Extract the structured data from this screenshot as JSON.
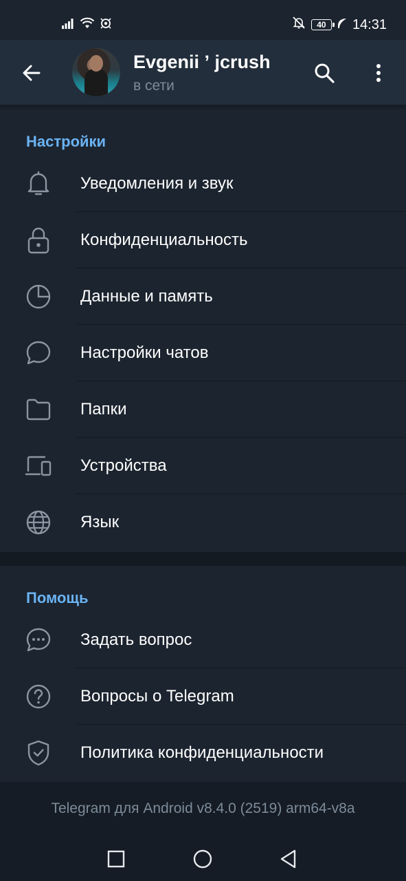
{
  "status_bar": {
    "time": "14:31",
    "battery": "40",
    "signal_icon": "signal-icon",
    "wifi_icon": "wifi-icon",
    "nfc_icon": "nfc-icon",
    "mute_icon": "bell-off-icon",
    "leaf_icon": "leaf-icon"
  },
  "header": {
    "name": "Evgenii ʼ jcrush",
    "status": "в сети",
    "back_icon": "arrow-left-icon",
    "search_icon": "search-icon",
    "more_icon": "more-vertical-icon"
  },
  "settings": {
    "title": "Настройки",
    "items": [
      {
        "label": "Уведомления и звук",
        "icon": "bell-icon"
      },
      {
        "label": "Конфиденциальность",
        "icon": "lock-icon"
      },
      {
        "label": "Данные и память",
        "icon": "pie-chart-icon"
      },
      {
        "label": "Настройки чатов",
        "icon": "chat-bubble-icon"
      },
      {
        "label": "Папки",
        "icon": "folder-icon"
      },
      {
        "label": "Устройства",
        "icon": "devices-icon"
      },
      {
        "label": "Язык",
        "icon": "globe-icon"
      }
    ]
  },
  "help": {
    "title": "Помощь",
    "items": [
      {
        "label": "Задать вопрос",
        "icon": "chat-dots-icon"
      },
      {
        "label": "Вопросы о Telegram",
        "icon": "question-circle-icon"
      },
      {
        "label": "Политика конфиденциальности",
        "icon": "shield-check-icon"
      }
    ]
  },
  "footer": {
    "version": "Telegram для Android v8.4.0 (2519) arm64-v8a"
  },
  "nav_bar": {
    "recents_icon": "square-icon",
    "home_icon": "circle-icon",
    "back_icon": "triangle-back-icon"
  },
  "colors": {
    "background": "#1c242f",
    "appbar": "#232e3c",
    "accent": "#6ab3f3",
    "secondary_text": "#7d8b99",
    "icon": "#8b96a2"
  }
}
